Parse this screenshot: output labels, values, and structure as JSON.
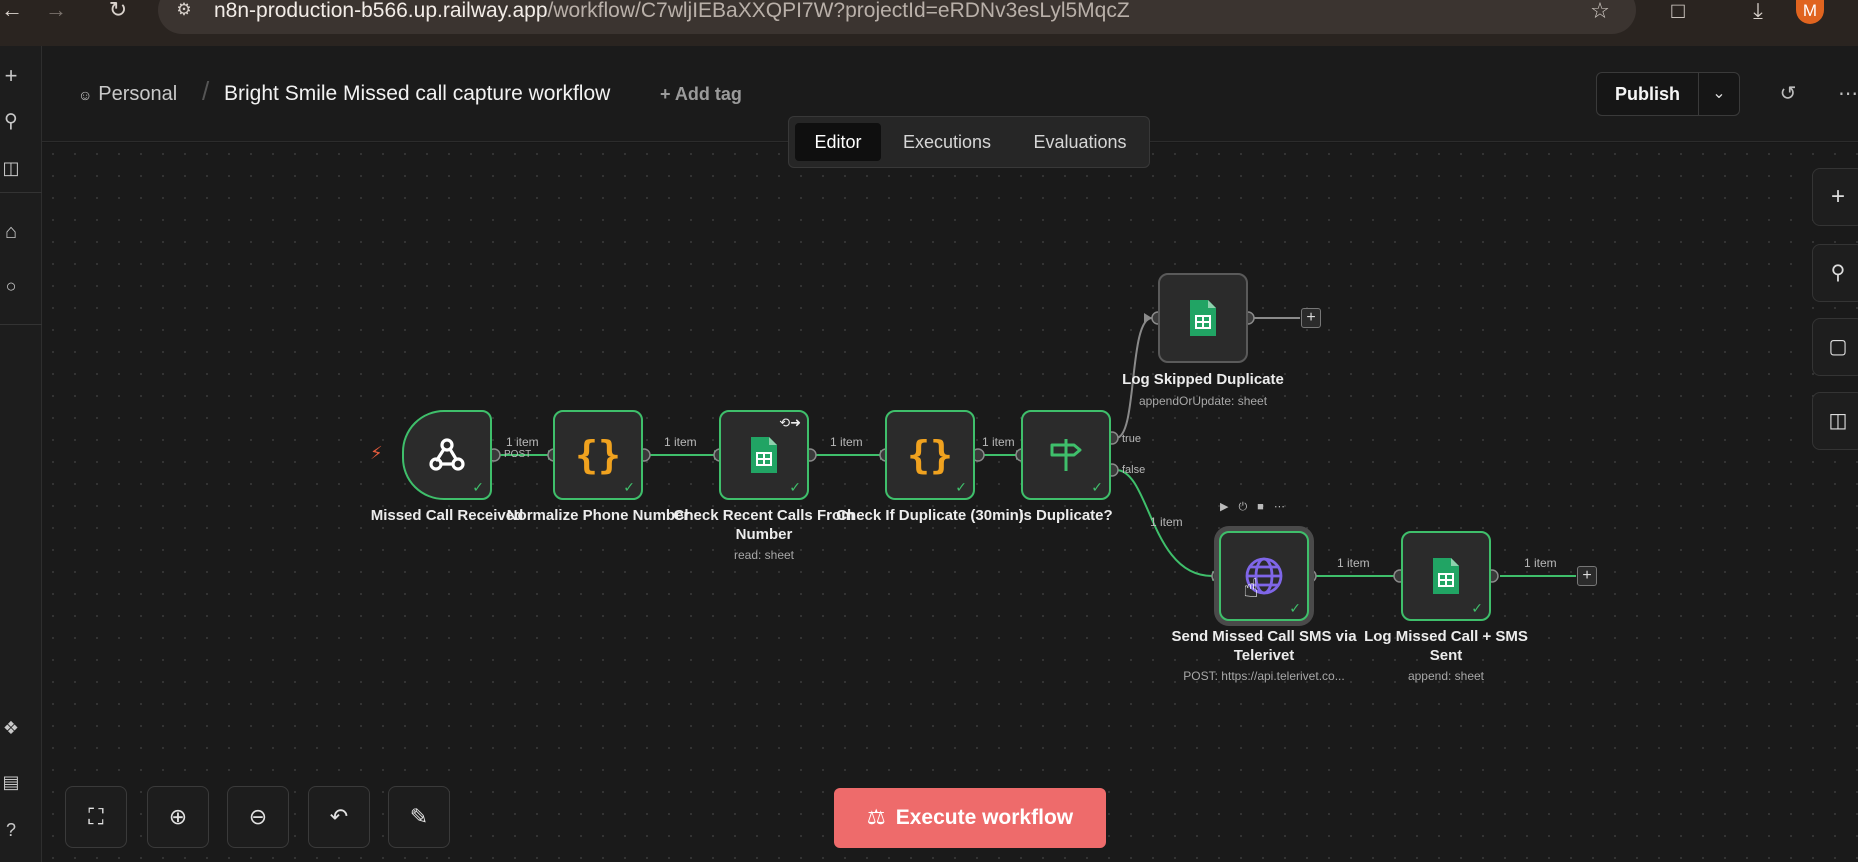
{
  "browser": {
    "url_host": "n8n-production-b566.up.railway.app",
    "url_path": "/workflow/C7wljIEBaXXQPI7W?projectId=eRDNv3esLyl5MqcZ",
    "avatar_letter": "M",
    "icons": [
      "back-icon",
      "forward-icon",
      "reload-icon",
      "site-settings-icon",
      "star-icon",
      "extensions-icon",
      "download-icon"
    ]
  },
  "header": {
    "project": "Personal",
    "separator": "/",
    "title": "Bright Smile Missed call capture workflow",
    "add_tag": "+ Add tag",
    "publish": "Publish"
  },
  "tabs": [
    {
      "label": "Editor",
      "active": true
    },
    {
      "label": "Executions",
      "active": false
    },
    {
      "label": "Evaluations",
      "active": false
    }
  ],
  "nodes": {
    "missed_call": {
      "label": "Missed Call Received",
      "sub": ""
    },
    "normalize": {
      "label": "Normalize Phone Number",
      "sub": ""
    },
    "check_recent": {
      "label": "Check Recent Calls From Number",
      "sub": "read: sheet"
    },
    "check_dup": {
      "label": "Check If Duplicate (30min)",
      "sub": ""
    },
    "is_dup": {
      "label": "Is Duplicate?",
      "sub": ""
    },
    "log_skipped": {
      "label": "Log Skipped Duplicate",
      "sub": "appendOrUpdate: sheet"
    },
    "send_sms": {
      "label": "Send Missed Call SMS via Telerivet",
      "sub": "POST: https://api.telerivet.co..."
    },
    "log_missed": {
      "label": "Log Missed Call + SMS Sent",
      "sub": "append: sheet"
    }
  },
  "edges": {
    "e1_count": "1 item",
    "e1_method": "POST",
    "e2_count": "1 item",
    "e3_count": "1 item",
    "e4_count": "1 item",
    "true_label": "true",
    "false_label": "false",
    "e5_count": "1 item",
    "e6_count": "1 item",
    "e7_count": "1 item"
  },
  "execute": {
    "label": "Execute workflow"
  },
  "colors": {
    "accent_green": "#3fbf6b",
    "execute_red": "#ee6b6b",
    "code_orange": "#f0a21f",
    "sheets_green": "#21a464",
    "http_purple": "#7f66e8"
  }
}
